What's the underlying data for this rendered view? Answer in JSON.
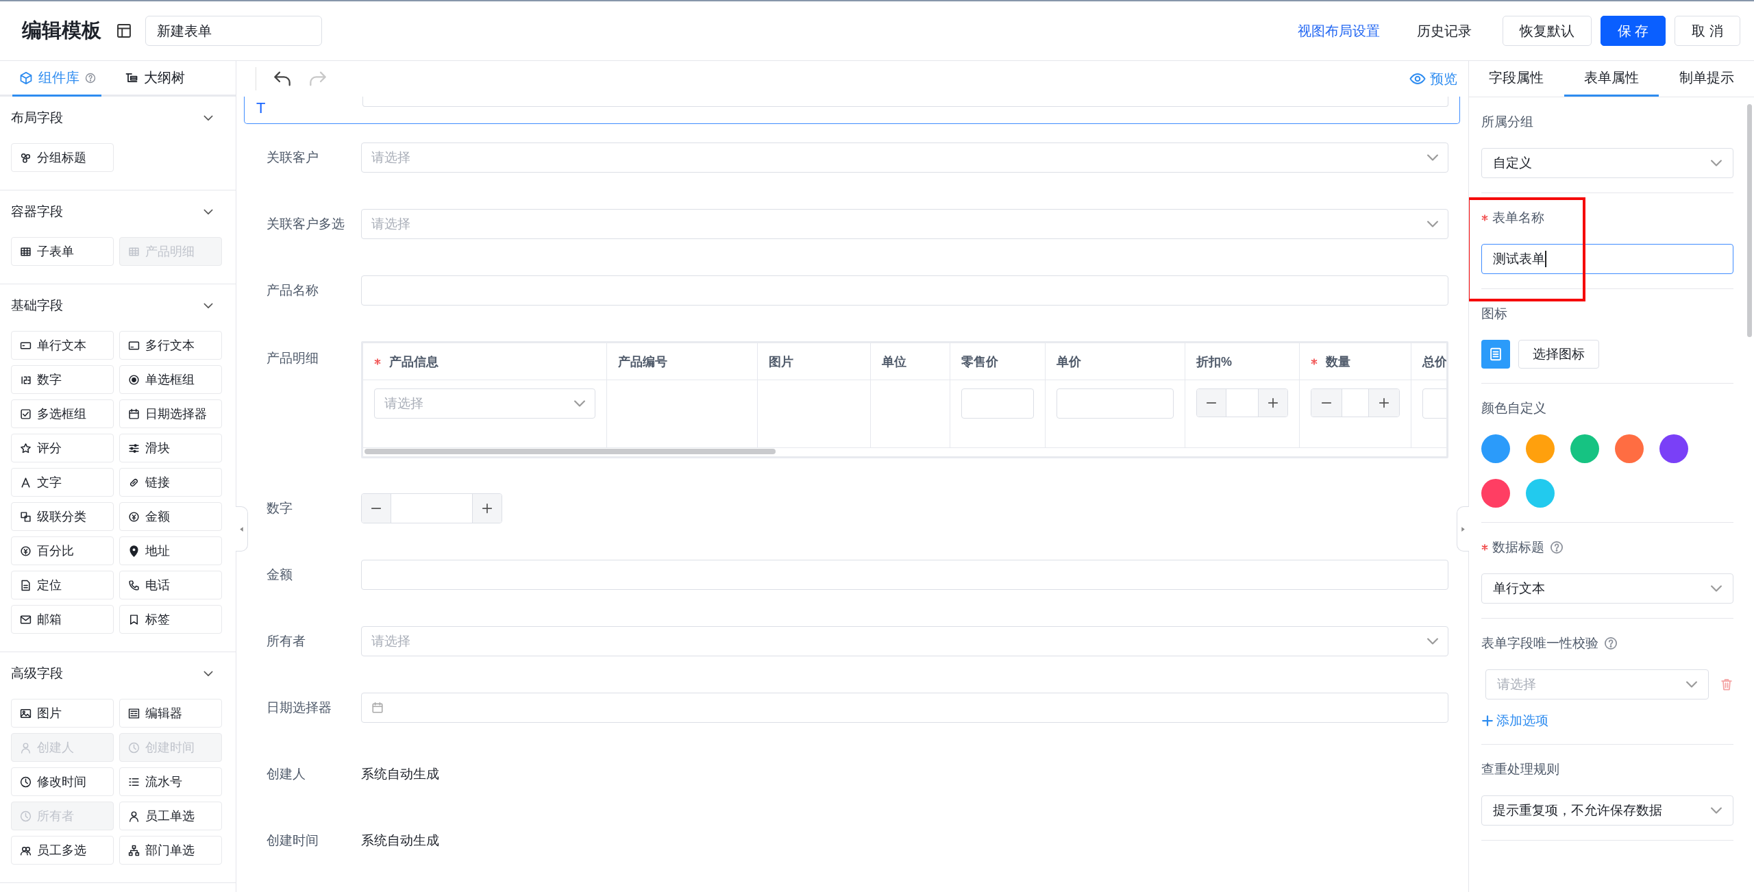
{
  "header": {
    "title": "编辑模板",
    "form_name": "新建表单",
    "view_layout_link": "视图布局设置",
    "history_link": "历史记录",
    "buttons": [
      {
        "label": "恢复默认",
        "kind": "default"
      },
      {
        "label": "保 存",
        "kind": "primary"
      },
      {
        "label": "取 消",
        "kind": "default"
      }
    ]
  },
  "left_panel": {
    "tabs": [
      {
        "label": "组件库",
        "selected": true,
        "help": true
      },
      {
        "label": "大纲树",
        "selected": false,
        "help": false
      }
    ],
    "groups": [
      {
        "title": "布局字段",
        "expanded": true,
        "items": [
          {
            "label": "分组标题",
            "disabled": false
          }
        ]
      },
      {
        "title": "容器字段",
        "expanded": true,
        "items": [
          {
            "label": "子表单",
            "disabled": false
          },
          {
            "label": "产品明细",
            "disabled": true
          }
        ]
      },
      {
        "title": "基础字段",
        "expanded": true,
        "items": [
          {
            "label": "单行文本",
            "disabled": false
          },
          {
            "label": "多行文本",
            "disabled": false
          },
          {
            "label": "数字",
            "disabled": false
          },
          {
            "label": "单选框组",
            "disabled": false
          },
          {
            "label": "多选框组",
            "disabled": false
          },
          {
            "label": "日期选择器",
            "disabled": false
          },
          {
            "label": "评分",
            "disabled": false
          },
          {
            "label": "滑块",
            "disabled": false
          },
          {
            "label": "文字",
            "disabled": false
          },
          {
            "label": "链接",
            "disabled": false
          },
          {
            "label": "级联分类",
            "disabled": false
          },
          {
            "label": "金额",
            "disabled": false
          },
          {
            "label": "百分比",
            "disabled": false
          },
          {
            "label": "地址",
            "disabled": false
          },
          {
            "label": "定位",
            "disabled": false
          },
          {
            "label": "电话",
            "disabled": false
          },
          {
            "label": "邮箱",
            "disabled": false
          },
          {
            "label": "标签",
            "disabled": false
          }
        ]
      },
      {
        "title": "高级字段",
        "expanded": true,
        "items": [
          {
            "label": "图片",
            "disabled": false
          },
          {
            "label": "编辑器",
            "disabled": false
          },
          {
            "label": "创建人",
            "disabled": true
          },
          {
            "label": "创建时间",
            "disabled": true
          },
          {
            "label": "修改时间",
            "disabled": false
          },
          {
            "label": "流水号",
            "disabled": false
          },
          {
            "label": "所有者",
            "disabled": true
          },
          {
            "label": "员工单选",
            "disabled": false
          },
          {
            "label": "员工多选",
            "disabled": false
          },
          {
            "label": "部门单选",
            "disabled": false
          }
        ]
      }
    ]
  },
  "toolbar": {
    "undo": {
      "disabled": false
    },
    "redo": {
      "disabled": true
    },
    "preview": "预览"
  },
  "form": {
    "selected_field_text": "T",
    "fields": [
      {
        "label": "关联客户",
        "kind": "select",
        "placeholder": "请选择"
      },
      {
        "label": "关联客户多选",
        "kind": "select",
        "placeholder": "请选择"
      },
      {
        "label": "产品名称",
        "kind": "text"
      },
      {
        "label": "产品明细",
        "kind": "table",
        "columns": [
          {
            "label": "产品信息",
            "required": true,
            "kind": "select",
            "placeholder": "请选择"
          },
          {
            "label": "产品编号",
            "required": false,
            "kind": "empty"
          },
          {
            "label": "图片",
            "required": false,
            "kind": "empty"
          },
          {
            "label": "单位",
            "required": false,
            "kind": "empty"
          },
          {
            "label": "零售价",
            "required": false,
            "kind": "input"
          },
          {
            "label": "单价",
            "required": false,
            "kind": "input"
          },
          {
            "label": "折扣%",
            "required": false,
            "kind": "stepper"
          },
          {
            "label": "数量",
            "required": true,
            "kind": "stepper"
          },
          {
            "label": "总价",
            "required": false,
            "kind": "input"
          }
        ]
      },
      {
        "label": "数字",
        "kind": "number"
      },
      {
        "label": "金额",
        "kind": "text"
      },
      {
        "label": "所有者",
        "kind": "select",
        "placeholder": "请选择"
      },
      {
        "label": "日期选择器",
        "kind": "date"
      },
      {
        "label": "创建人",
        "kind": "static",
        "value": "系统自动生成"
      },
      {
        "label": "创建时间",
        "kind": "static",
        "value": "系统自动生成"
      }
    ]
  },
  "right_panel": {
    "tabs": [
      {
        "label": "字段属性",
        "selected": false
      },
      {
        "label": "表单属性",
        "selected": true
      },
      {
        "label": "制单提示",
        "selected": false
      }
    ],
    "sections": [
      {
        "kind": "select",
        "label": "所属分组",
        "required": false,
        "help": false,
        "value": "自定义"
      },
      {
        "kind": "input",
        "label": "表单名称",
        "required": true,
        "help": false,
        "value": "测试表单",
        "focused": true,
        "highlighted": true
      },
      {
        "kind": "icon_picker",
        "label": "图标",
        "required": false,
        "help": false,
        "button": "选择图标"
      },
      {
        "kind": "colors",
        "label": "颜色自定义",
        "required": false,
        "help": false,
        "colors": [
          {
            "color": "#2b9bfa"
          },
          {
            "color": "#ffa00d"
          },
          {
            "color": "#16c382"
          },
          {
            "color": "#ff6d42"
          },
          {
            "color": "#7a40f7"
          },
          {
            "color": "#ff3e63"
          },
          {
            "color": "#22caee"
          }
        ]
      },
      {
        "kind": "select",
        "label": "数据标题",
        "required": true,
        "help": true,
        "value": "单行文本"
      },
      {
        "kind": "rule_list",
        "label": "表单字段唯一性校验",
        "required": false,
        "help": true,
        "placeholder": "请选择",
        "add": "添加选项"
      },
      {
        "kind": "select",
        "label": "查重处理规则",
        "required": false,
        "help": false,
        "value": "提示重复项，不允许保存数据"
      }
    ]
  }
}
